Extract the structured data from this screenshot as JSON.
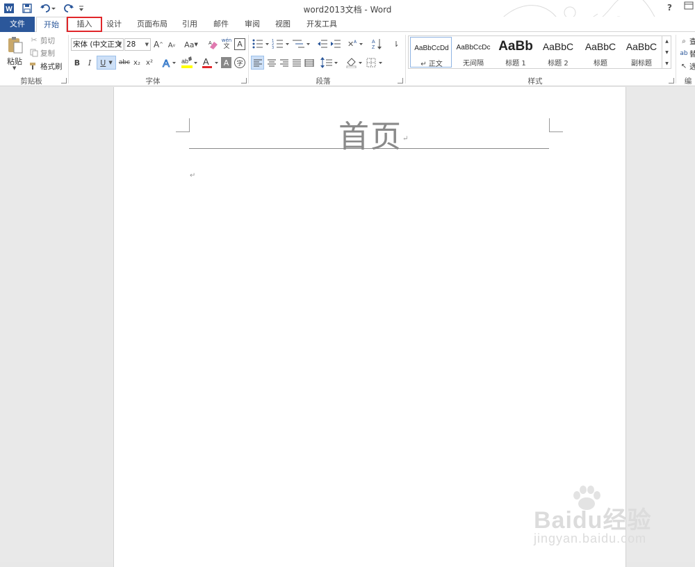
{
  "window": {
    "title": "word2013文档 - Word",
    "help": "?"
  },
  "quick_access": {
    "app_icon": "word-icon",
    "save_icon": "save-icon",
    "undo_icon": "undo-icon",
    "redo_icon": "redo-icon",
    "customize_icon": "customize-qat-icon"
  },
  "tabs": [
    {
      "label": "文件",
      "state": "file"
    },
    {
      "label": "开始",
      "state": "selected"
    },
    {
      "label": "插入",
      "state": "highlighted",
      "highlight_color": "#e0262a"
    },
    {
      "label": "设计"
    },
    {
      "label": "页面布局"
    },
    {
      "label": "引用"
    },
    {
      "label": "邮件"
    },
    {
      "label": "审阅"
    },
    {
      "label": "视图"
    },
    {
      "label": "开发工具"
    }
  ],
  "ribbon": {
    "clipboard": {
      "label": "剪贴板",
      "paste": "粘贴",
      "cut": "剪切",
      "copy": "复制",
      "format_painter": "格式刷"
    },
    "font": {
      "label": "字体",
      "font_name": "宋体 (中文正文",
      "font_size": "28",
      "change_case": "Aa",
      "phonetic_top": "wén",
      "phonetic_bottom": "文",
      "strike": "abc",
      "bold": "B",
      "italic": "I",
      "underline": "U",
      "subscript": "x₂",
      "superscript": "x²",
      "font_color": "A",
      "char_shading": "A",
      "enclose": "字",
      "grow": "A",
      "shrink": "A",
      "border_char": "A"
    },
    "paragraph": {
      "label": "段落"
    },
    "styles": {
      "label": "样式",
      "items": [
        {
          "sample": "AaBbCcDd",
          "name": "↵ 正文",
          "selected": true
        },
        {
          "sample": "AaBbCcDc",
          "name": "无间隔"
        },
        {
          "sample": "AaBb",
          "name": "标题 1"
        },
        {
          "sample": "AaBbC",
          "name": "标题 2"
        },
        {
          "sample": "AaBbC",
          "name": "标题"
        },
        {
          "sample": "AaBbC",
          "name": "副标题"
        }
      ]
    },
    "editing": {
      "find": "查",
      "replace": "替",
      "select": "选",
      "label": "编"
    }
  },
  "document": {
    "heading": "首页",
    "paragraph_mark": "↵"
  },
  "watermark": {
    "brand": "Baidu经验",
    "url": "jingyan.baidu.com"
  },
  "colors": {
    "accent": "#2b579a",
    "highlight": "#e0262a",
    "font_color_bar": "#e0262a",
    "highlight_bar": "#ffff00"
  }
}
